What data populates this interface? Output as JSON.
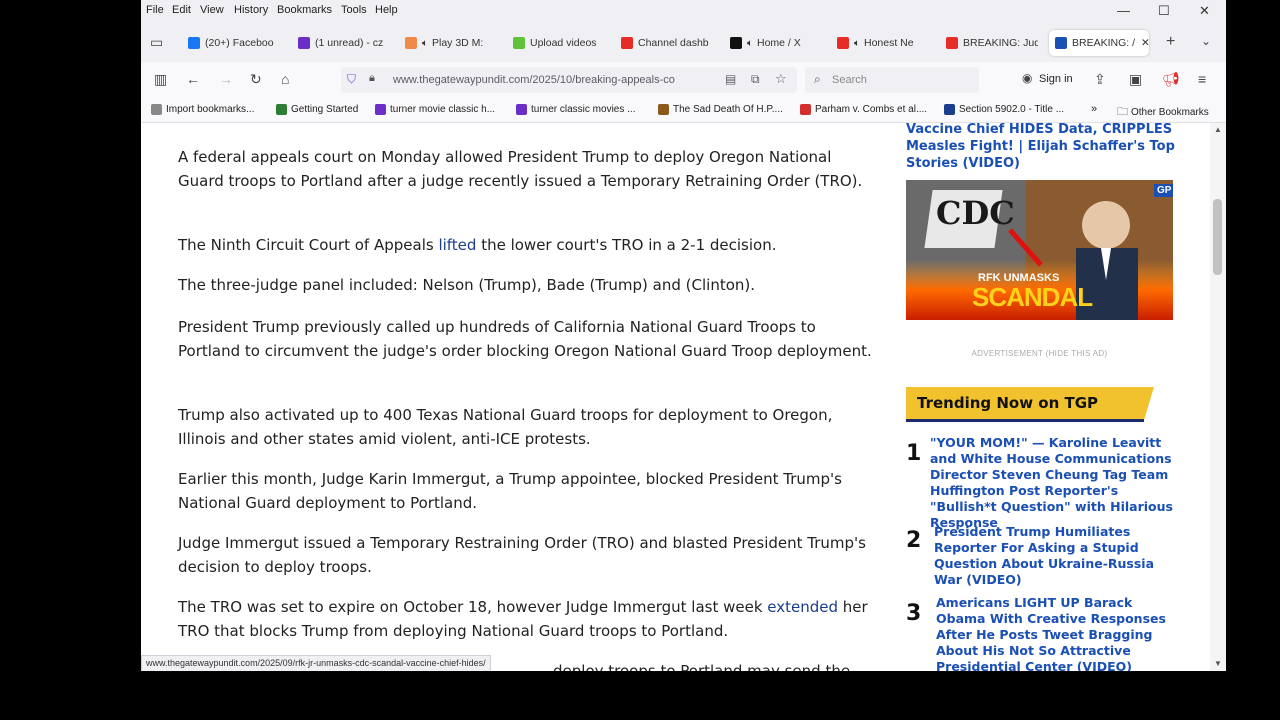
{
  "menu": [
    "File",
    "Edit",
    "View",
    "History",
    "Bookmarks",
    "Tools",
    "Help"
  ],
  "window_controls": {
    "minimize": "—",
    "maximize": "☐",
    "close": "✕"
  },
  "tabs": [
    {
      "label": "(20+) Faceboo",
      "color": "#1877f2",
      "sound": false
    },
    {
      "label": "(1 unread) - cz",
      "color": "#6b2fc8",
      "sound": false
    },
    {
      "label": "Play 3D M:",
      "color": "#f08a4b",
      "sound": true
    },
    {
      "label": "Upload videos",
      "color": "#5ec23c",
      "sound": false
    },
    {
      "label": "Channel dashb",
      "color": "#e52d27",
      "sound": false
    },
    {
      "label": "Home / X",
      "color": "#111111",
      "sound": true
    },
    {
      "label": "Honest Ne",
      "color": "#e52d27",
      "sound": true
    },
    {
      "label": "BREAKING: Jud",
      "color": "#e52d27",
      "sound": false
    },
    {
      "label": "BREAKING: /",
      "color": "#1a4fb4",
      "sound": false
    }
  ],
  "url": "www.thegatewaypundit.com/2025/10/breaking-appeals-co",
  "search_placeholder": "Search",
  "sign_in": "Sign in",
  "bookmarks": [
    {
      "label": "Import bookmarks...",
      "color": "#888888"
    },
    {
      "label": "Getting Started",
      "color": "#2e7d32"
    },
    {
      "label": "turner movie classic h...",
      "color": "#6b2fc8"
    },
    {
      "label": "turner classic movies ...",
      "color": "#6b2fc8"
    },
    {
      "label": "The Sad Death Of H.P....",
      "color": "#8a5a1a"
    },
    {
      "label": "Parham v. Combs et al....",
      "color": "#d32f2f"
    },
    {
      "label": "Section 5902.0 - Title ...",
      "color": "#1a3e8c"
    }
  ],
  "other_bookmarks": "Other Bookmarks",
  "article": {
    "p1": "A federal appeals court on Monday allowed President Trump to deploy Oregon National Guard troops to Portland after a judge recently issued a Temporary Retraining Order (TRO).",
    "p2_pre": "The Ninth Circuit Court of Appeals ",
    "p2_link": "lifted",
    "p2_post": " the lower court's TRO in a 2-1 decision.",
    "p3": "The three-judge panel included: Nelson (Trump), Bade (Trump) and (Clinton).",
    "p4": "President Trump previously called up hundreds of California National Guard Troops to Portland to circumvent the judge's order blocking Oregon National Guard Troop deployment.",
    "p5": "Trump also activated up to 400 Texas National Guard troops for deployment to Oregon, Illinois and other states amid violent, anti-ICE protests.",
    "p6": "Earlier this month, Judge Karin Immergut, a Trump appointee, blocked President Trump's National Guard deployment to Portland.",
    "p7": "Judge Immergut issued a Temporary Restraining Order (TRO) and blasted President Trump's decision to deploy troops.",
    "p8_pre": "The TRO was set to expire on October 18, however Judge Immergut last week ",
    "p8_link": "extended",
    "p8_post": " her TRO that blocks Trump from deploying National Guard troops to Portland.",
    "p9_partial": "deploy troops to Portland may send the"
  },
  "sidebar": {
    "headline": "Vaccine Chief HIDES Data, CRIPPLES Measles Fight! | Elijah Schaffer's Top Stories (VIDEO)",
    "ad_badge": "GP",
    "ad_cdc": "CDC",
    "ad_caption1": "RFK UNMASKS",
    "ad_caption2": "SCANDAL",
    "ad_label": "ADVERTISEMENT (HIDE THIS AD)",
    "trending_title": "Trending Now on TGP",
    "trending": [
      {
        "num": "1",
        "title": "\"YOUR MOM!\" — Karoline Leavitt and White House Communications Director Steven Cheung Tag Team Huffington Post Reporter's \"Bullish*t Question\" with Hilarious Response"
      },
      {
        "num": "2",
        "title": "President Trump Humiliates Reporter For Asking a Stupid Question About Ukraine-Russia War (VIDEO)"
      },
      {
        "num": "3",
        "title": "Americans LIGHT UP Barack Obama With Creative Responses After He Posts Tweet Bragging About His Not So Attractive Presidential Center (VIDEO)"
      }
    ]
  },
  "status_url": "www.thegatewaypundit.com/2025/09/rfk-jr-unmasks-cdc-scandal-vaccine-chief-hides/"
}
